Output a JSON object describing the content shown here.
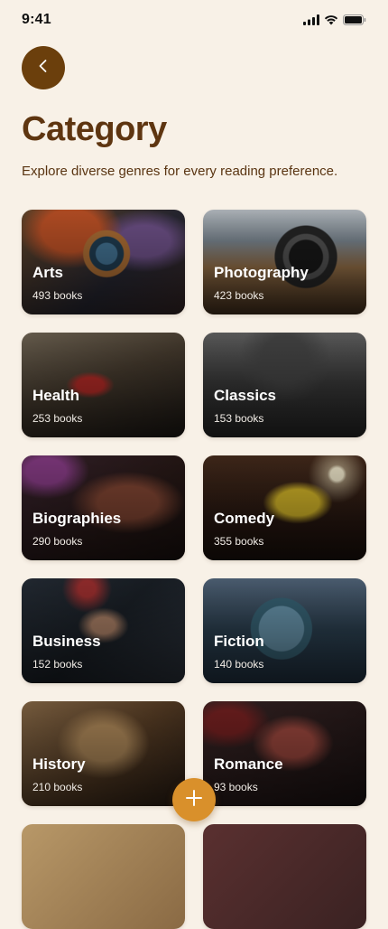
{
  "status_bar": {
    "time": "9:41"
  },
  "header": {
    "title": "Category",
    "subtitle": "Explore diverse genres for every reading preference."
  },
  "categories": [
    {
      "name": "Arts",
      "count": "493 books"
    },
    {
      "name": "Photography",
      "count": "423 books"
    },
    {
      "name": "Health",
      "count": "253 books"
    },
    {
      "name": "Classics",
      "count": "153 books"
    },
    {
      "name": "Biographies",
      "count": "290 books"
    },
    {
      "name": "Comedy",
      "count": "355 books"
    },
    {
      "name": "Business",
      "count": "152 books"
    },
    {
      "name": "Fiction",
      "count": "140 books"
    },
    {
      "name": "History",
      "count": "210 books"
    },
    {
      "name": "Romance",
      "count": "93 books"
    }
  ],
  "icons": {
    "back": "chevron-left-icon",
    "fab": "plus-icon",
    "signal": "cellular-signal-icon",
    "wifi": "wifi-icon",
    "battery": "battery-icon"
  },
  "colors": {
    "background": "#f8f1e7",
    "accent_brown": "#6b3f0c",
    "fab_orange": "#d9902b",
    "title_brown": "#5e3510"
  }
}
